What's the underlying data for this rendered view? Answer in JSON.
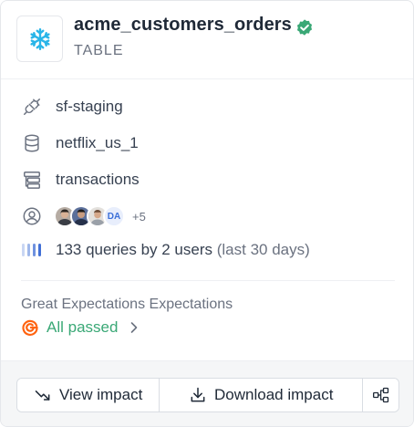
{
  "header": {
    "title": "acme_customers_orders",
    "type_label": "TABLE",
    "logo_icon": "snowflake-icon",
    "verified_icon": "verified-badge-icon",
    "colors": {
      "snowflake": "#29b5e8",
      "verified": "#3aa876"
    }
  },
  "details": {
    "connection": {
      "icon": "plug-icon",
      "label": "sf-staging"
    },
    "database": {
      "icon": "database-icon",
      "label": "netflix_us_1"
    },
    "schema": {
      "icon": "schema-icon",
      "label": "transactions"
    },
    "owners": {
      "icon": "user-circle-icon",
      "initials": "DA",
      "more_count": "+5"
    },
    "queries": {
      "icon": "usage-bars-icon",
      "label": "133 queries by 2 users",
      "period": "(last 30 days)"
    }
  },
  "quality": {
    "title": "Great Expectations Expectations",
    "status": "All passed",
    "status_icon": "great-expectations-icon",
    "colors": {
      "brand": "#ff6310",
      "success": "#3aa876"
    }
  },
  "actions": {
    "view_impact": "View impact",
    "download_impact": "Download impact",
    "graph_icon": "lineage-graph-icon"
  }
}
